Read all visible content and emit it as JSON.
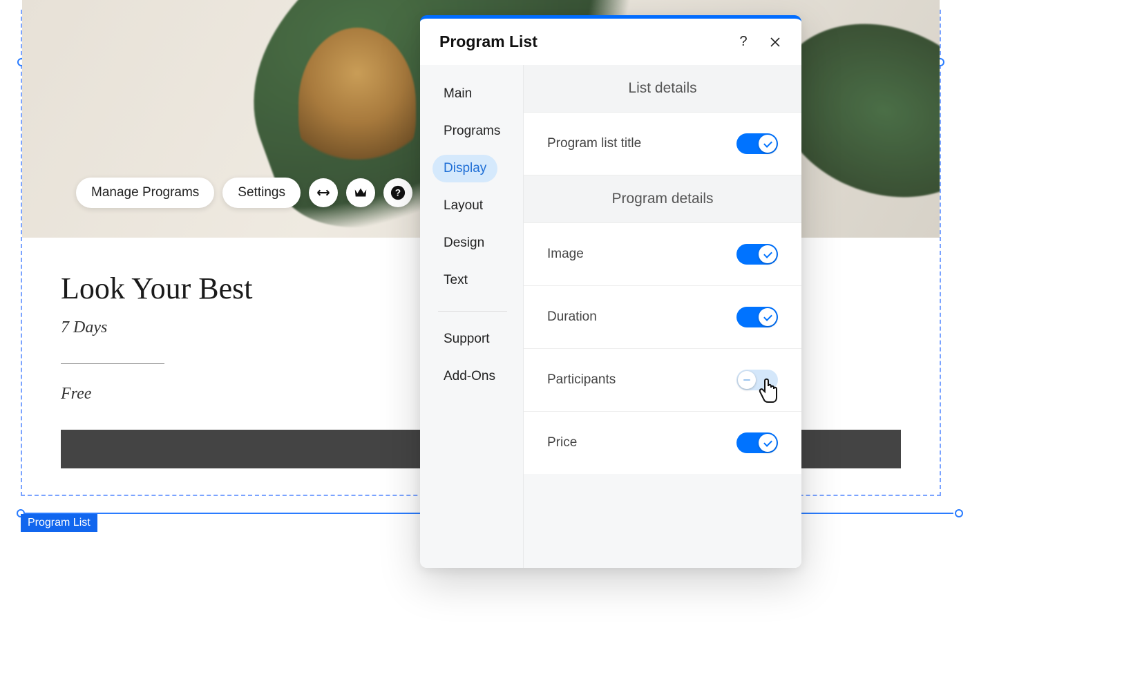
{
  "selection_label": "Program List",
  "toolbar": {
    "manage_label": "Manage Programs",
    "settings_label": "Settings"
  },
  "program": {
    "title": "Look Your Best",
    "duration": "7 Days",
    "price": "Free"
  },
  "modal": {
    "title": "Program List",
    "sidebar": {
      "main": "Main",
      "programs": "Programs",
      "display": "Display",
      "layout": "Layout",
      "design": "Design",
      "text": "Text",
      "support": "Support",
      "addons": "Add-Ons"
    },
    "sections": {
      "list_details": "List details",
      "program_details": "Program details"
    },
    "settings": {
      "program_list_title": {
        "label": "Program list title",
        "on": true
      },
      "image": {
        "label": "Image",
        "on": true
      },
      "duration": {
        "label": "Duration",
        "on": true
      },
      "participants": {
        "label": "Participants",
        "on": false
      },
      "price": {
        "label": "Price",
        "on": true
      }
    }
  }
}
